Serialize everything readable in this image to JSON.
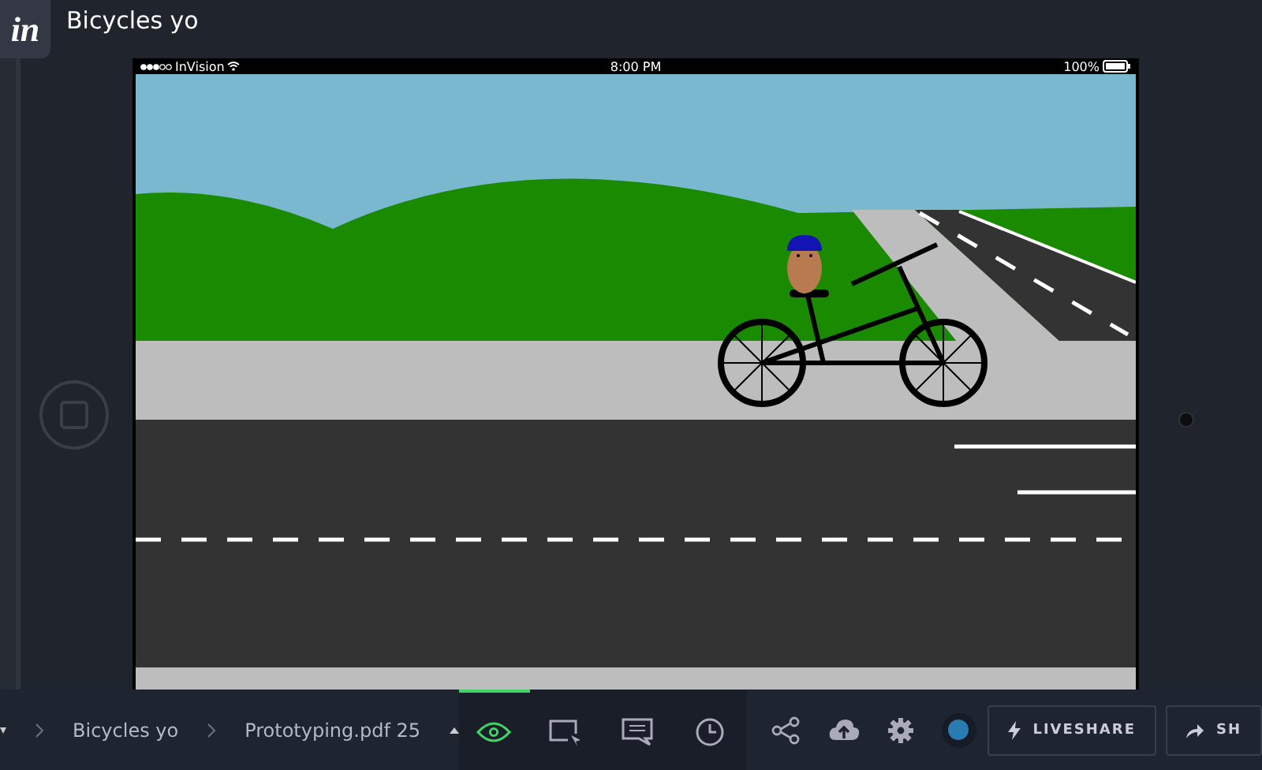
{
  "header": {
    "logo": "in",
    "title": "Bicycles yo"
  },
  "status_bar": {
    "carrier": "InVision",
    "time": "8:00 PM",
    "battery": "100%"
  },
  "toolbar": {
    "breadcrumbs": [
      "Bicycles yo",
      "Prototyping.pdf 25"
    ],
    "modes": [
      {
        "kind": "preview",
        "selected": true
      },
      {
        "kind": "inspect",
        "selected": false
      },
      {
        "kind": "comment",
        "selected": false
      },
      {
        "kind": "history",
        "selected": false
      }
    ],
    "actions": [
      {
        "kind": "share"
      },
      {
        "kind": "upload"
      },
      {
        "kind": "settings"
      },
      {
        "kind": "status",
        "color": "#2a7bb0"
      }
    ],
    "buttons": [
      {
        "kind": "liveshare",
        "label": "LIVESHARE"
      },
      {
        "kind": "share",
        "label": "SH"
      }
    ]
  }
}
